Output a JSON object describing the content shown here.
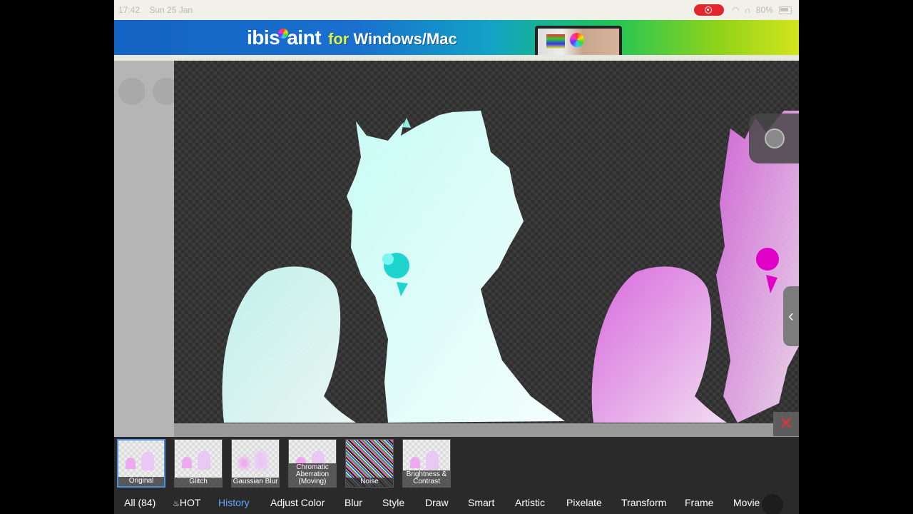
{
  "status_bar": {
    "time": "17:42",
    "date": "Sun 25 Jan",
    "battery": "80%",
    "icons": [
      "record-icon",
      "wifi-icon",
      "headphones-icon",
      "battery-icon"
    ]
  },
  "banner": {
    "logo_pre": "ibis",
    "logo_post": "aint",
    "tagline_for": "for",
    "tagline_rest": "Windows/Mac"
  },
  "filters": [
    {
      "label": "Original",
      "selected": true
    },
    {
      "label": "Glitch"
    },
    {
      "label": "Gaussian Blur"
    },
    {
      "label": "Chromatic Aberration (Moving)"
    },
    {
      "label": "Noise"
    },
    {
      "label": "Brightness & Contrast"
    }
  ],
  "categories": [
    {
      "label": "All (84)"
    },
    {
      "label": "HOT",
      "icon": "flame-icon"
    },
    {
      "label": "History",
      "active": true
    },
    {
      "label": "Adjust Color"
    },
    {
      "label": "Blur"
    },
    {
      "label": "Style"
    },
    {
      "label": "Draw"
    },
    {
      "label": "Smart"
    },
    {
      "label": "Artistic"
    },
    {
      "label": "Pixelate"
    },
    {
      "label": "Transform"
    },
    {
      "label": "Frame"
    },
    {
      "label": "Movie"
    }
  ],
  "colors": {
    "accent": "#5ea6ff",
    "record": "#e1262e",
    "close": "#e0323a"
  }
}
